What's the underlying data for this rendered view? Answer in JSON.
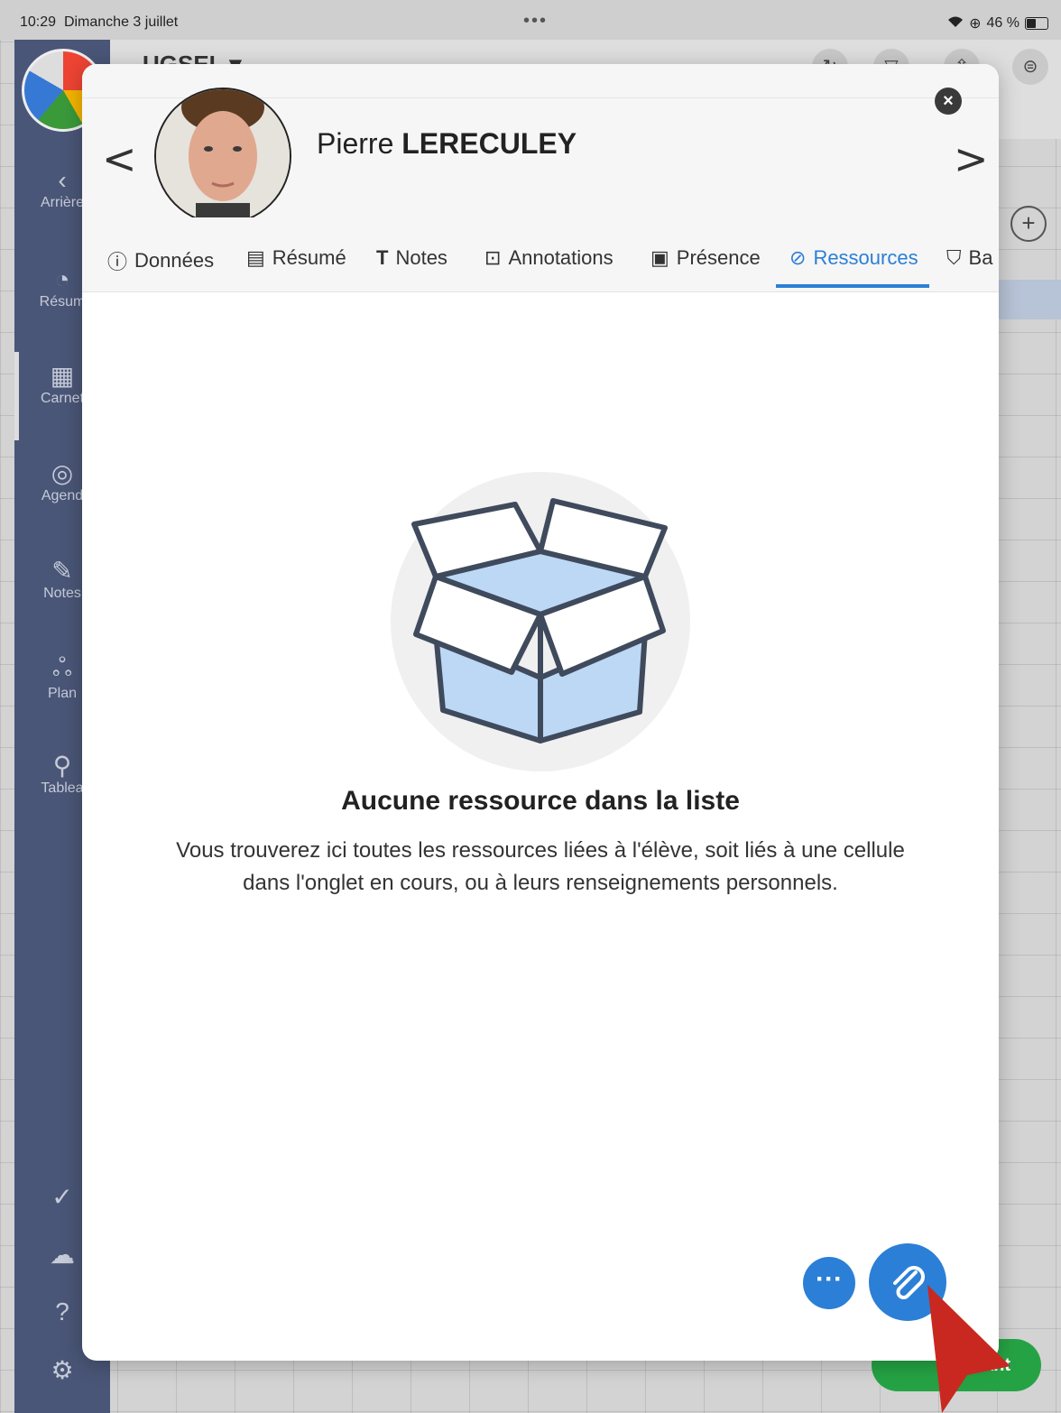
{
  "status_bar": {
    "time": "10:29",
    "date": "Dimanche 3 juillet",
    "dots": "•••",
    "battery": "46 %"
  },
  "topbar": {
    "title": "UGSEL ▾"
  },
  "sidebar": {
    "items": [
      {
        "label": "Arrière",
        "icon": "back-icon"
      },
      {
        "label": "Résum",
        "icon": "pie-chart-icon"
      },
      {
        "label": "Carnet",
        "icon": "grid-icon"
      },
      {
        "label": "Agend",
        "icon": "agenda-icon"
      },
      {
        "label": "Notes",
        "icon": "pencil-icon"
      },
      {
        "label": "Plan",
        "icon": "people-icon"
      },
      {
        "label": "Tablea",
        "icon": "pin-icon"
      }
    ]
  },
  "modal": {
    "first_name": "Pierre",
    "last_name": "LERECULEY",
    "tabs": [
      {
        "label": "Données",
        "icon": "user-circle-icon"
      },
      {
        "label": "Résumé",
        "icon": "list-icon"
      },
      {
        "label": "Notes",
        "icon": "text-icon"
      },
      {
        "label": "Annotations",
        "icon": "comment-icon"
      },
      {
        "label": "Présence",
        "icon": "calendar-check-icon"
      },
      {
        "label": "Ressources",
        "icon": "paperclip-icon",
        "active": true
      },
      {
        "label": "Ba",
        "icon": "badge-icon"
      }
    ],
    "empty_title": "Aucune ressource dans la liste",
    "empty_description": "Vous trouverez ici toutes les ressources liées à l'élève, soit liés à une cellule dans l'onglet en cours, ou à leurs renseignements personnels."
  },
  "green_button": {
    "label": "udiant"
  },
  "colors": {
    "accent": "#2b7fd6",
    "sidebar": "#4a5677",
    "green": "#25a344"
  }
}
